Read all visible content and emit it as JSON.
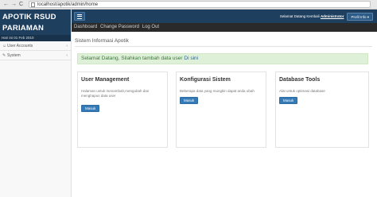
{
  "browser": {
    "back": "←",
    "forward": "→",
    "reload": "C",
    "url": "localhost/apotik/admin/home"
  },
  "sidebar": {
    "brand": "APOTIK RSUD PARIAMAN",
    "date": "Hari ini 01 Feb 2010",
    "items": [
      {
        "icon": "user-icon",
        "label": "User Accounts"
      },
      {
        "icon": "wrench-icon",
        "label": "System"
      }
    ]
  },
  "topbar": {
    "welcome_prefix": "Selamat Datang Kembali",
    "welcome_user": "Administrator",
    "profil_label": "Profil Info",
    "profil_caret": "▾"
  },
  "subbar": {
    "dashboard": "Dashboard",
    "change_password": "Change Password",
    "logout": "Log Out"
  },
  "main": {
    "title": "Sistem Informasi Apotik",
    "alert_text": "Selamat Datang, Silahkan tambah data user",
    "alert_link": "Di sini",
    "cards": [
      {
        "title": "User Management",
        "desc": "Halaman untuk menambah,mengubah dan menghapus data user",
        "button": "Masuk"
      },
      {
        "title": "Konfigurasi Sistem",
        "desc": "Beberapa data yang mungkin dapat anda ubah",
        "button": "Masuk"
      },
      {
        "title": "Database Tools",
        "desc": "Alat untuk optimasi database",
        "button": "Masuk"
      }
    ]
  },
  "colors": {
    "navy": "#1f3f5e",
    "button_blue": "#337ab7",
    "alert_bg": "#dff0d8"
  }
}
